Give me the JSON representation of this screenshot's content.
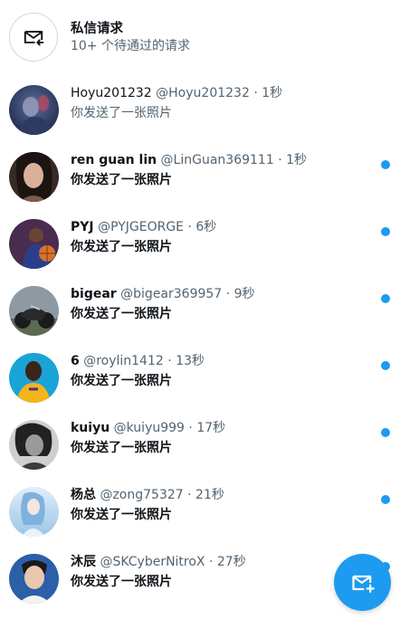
{
  "colors": {
    "accent": "#1d9bf0",
    "unread_dot": "#1d9bf0",
    "text_primary": "#0f1419",
    "text_secondary": "#536471"
  },
  "message_requests": {
    "icon": "mail-request-icon",
    "title": "私信请求",
    "subtitle": "10+ 个待通过的请求"
  },
  "conversations": [
    {
      "name": "Hoyu201232",
      "handle": "@Hoyu201232",
      "separator": "·",
      "time": "1秒",
      "message": "你发送了一张照片",
      "unread": false
    },
    {
      "name": "ren guan lin",
      "handle": "@LinGuan369111",
      "separator": "·",
      "time": "1秒",
      "message": "你发送了一张照片",
      "unread": true
    },
    {
      "name": "PYJ",
      "handle": "@PYJGEORGE",
      "separator": "·",
      "time": "6秒",
      "message": "你发送了一张照片",
      "unread": true
    },
    {
      "name": "bigear",
      "handle": "@bigear369957",
      "separator": "·",
      "time": "9秒",
      "message": "你发送了一张照片",
      "unread": true
    },
    {
      "name": "6",
      "handle": "@roylin1412",
      "separator": "·",
      "time": "13秒",
      "message": "你发送了一张照片",
      "unread": true
    },
    {
      "name": "kuiyu",
      "handle": "@kuiyu999",
      "separator": "·",
      "time": "17秒",
      "message": "你发送了一张照片",
      "unread": true
    },
    {
      "name": "杨总",
      "handle": "@zong75327",
      "separator": "·",
      "time": "21秒",
      "message": "你发送了一张照片",
      "unread": true
    },
    {
      "name": "沐辰",
      "handle": "@SKCyberNitroX",
      "separator": "·",
      "time": "27秒",
      "message": "你发送了一张照片",
      "unread": true
    }
  ],
  "compose_button": {
    "icon": "new-message-icon"
  }
}
